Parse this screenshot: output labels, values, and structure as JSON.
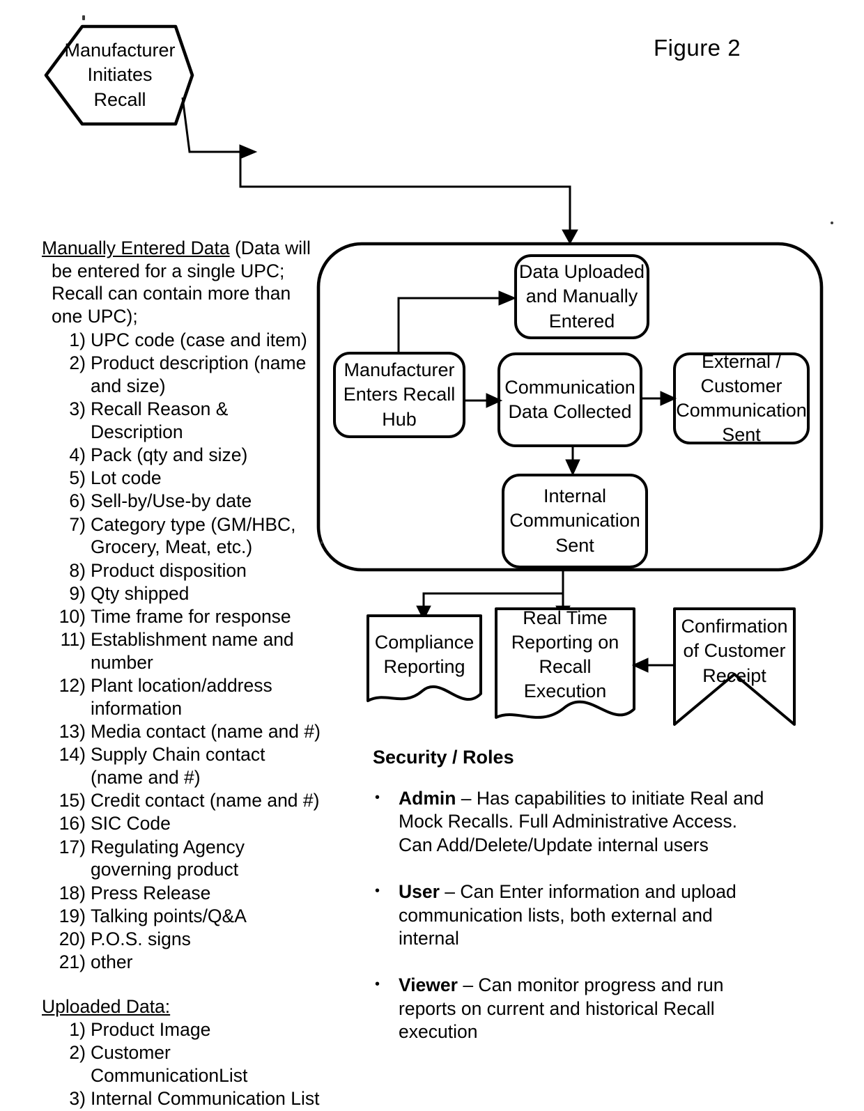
{
  "figure": {
    "label": "Figure 2"
  },
  "flow": {
    "start_node": "Manufacturer\nInitiates\nRecall",
    "hub_container_label": "",
    "nodes": {
      "data_uploaded": "Data Uploaded\nand Manually\nEntered",
      "manufacturer_hub": "Manufacturer\nEnters Recall\nHub",
      "communication_data": "Communication\nData Collected",
      "external_customer": "External /\nCustomer\nCommunication\nSent",
      "internal_communication": "Internal\nCommunication\nSent"
    },
    "reports": {
      "compliance": "Compliance\nReporting",
      "real_time": "Real Time\nReporting on\nRecall\nExecution",
      "confirmation": "Confirmation\nof Customer\nReceipt"
    }
  },
  "manual_data": {
    "heading": "Manually Entered Data",
    "heading_rest": " (Data will be entered for a single UPC; Recall can contain more than one UPC);",
    "items": [
      "UPC code (case and item)",
      "Product description (name and size)",
      "Recall Reason & Description",
      "Pack (qty and size)",
      "Lot code",
      "Sell-by/Use-by date",
      "Category type (GM/HBC, Grocery, Meat, etc.)",
      "Product disposition",
      "Qty shipped",
      "Time frame for response",
      "Establishment name and number",
      "Plant location/address information",
      "Media contact (name and #)",
      "Supply Chain contact (name and #)",
      "Credit contact (name and #)",
      "SIC Code",
      "Regulating Agency governing product",
      "Press Release",
      "Talking points/Q&A",
      "P.O.S. signs",
      "other"
    ]
  },
  "uploaded_data": {
    "heading": "Uploaded Data:",
    "items": [
      "Product Image",
      "Customer CommunicationList",
      "Internal Communication List"
    ]
  },
  "security_roles": {
    "title": "Security / Roles",
    "bullet_glyph": "•",
    "roles": [
      {
        "name": "Admin",
        "description": " – Has capabilities to initiate Real and Mock Recalls.  Full Administrative Access.  Can Add/Delete/Update internal users"
      },
      {
        "name": "User",
        "description": " – Can Enter information and upload communication lists, both external and internal"
      },
      {
        "name": "Viewer",
        "description": " – Can monitor progress and run reports on current and historical Recall execution"
      }
    ]
  },
  "colors": {
    "ink": "#000000",
    "page": "#ffffff"
  }
}
